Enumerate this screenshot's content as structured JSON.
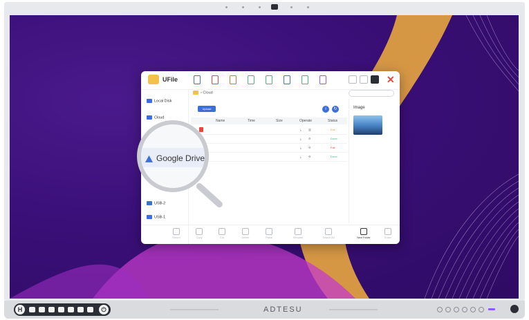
{
  "app": {
    "title": "UFile"
  },
  "window": {
    "close_glyph": "✕"
  },
  "breadcrumb": {
    "root": "Cloud"
  },
  "search": {
    "placeholder": ""
  },
  "sidebar": {
    "items": [
      {
        "label": "Local Disk",
        "icon": "disk-icon"
      },
      {
        "label": "Cloud",
        "icon": "cloud-icon"
      },
      {
        "label": "USB-2",
        "icon": "usb-icon"
      },
      {
        "label": "USB-1",
        "icon": "usb-icon"
      }
    ]
  },
  "actions": {
    "upload_label": "Upload"
  },
  "table": {
    "headers": [
      "Name",
      "Time",
      "Size",
      "Operate",
      "Status"
    ],
    "rows": [
      {
        "name": "",
        "time": "",
        "size": "",
        "status": "Exit"
      },
      {
        "name": "",
        "time": "",
        "size": "",
        "status": "Done"
      },
      {
        "name": "",
        "time": "",
        "size": "",
        "status": "Fail"
      },
      {
        "name": "",
        "time": "",
        "size": "",
        "status": "Done"
      }
    ]
  },
  "preview": {
    "title": "Image"
  },
  "magnifier": {
    "label": "Google Drive"
  },
  "toolbar": {
    "items": [
      {
        "label": "Return",
        "icon": "return-icon"
      },
      {
        "label": "Copy",
        "icon": "copy-icon"
      },
      {
        "label": "Cut",
        "icon": "cut-icon"
      },
      {
        "label": "Delete",
        "icon": "delete-icon"
      },
      {
        "label": "Paste",
        "icon": "paste-icon"
      },
      {
        "label": "Rename",
        "icon": "rename-icon"
      },
      {
        "label": "Search All",
        "icon": "search-all-icon"
      },
      {
        "label": "New Folder",
        "icon": "new-folder-icon"
      },
      {
        "label": "Share",
        "icon": "share-icon"
      }
    ]
  },
  "hardware": {
    "brand": "ADTESU"
  },
  "colors": {
    "accent": "#3d6fd8",
    "close": "#e8453c",
    "done": "#41b883",
    "screen_bg": "#3a0f78"
  }
}
